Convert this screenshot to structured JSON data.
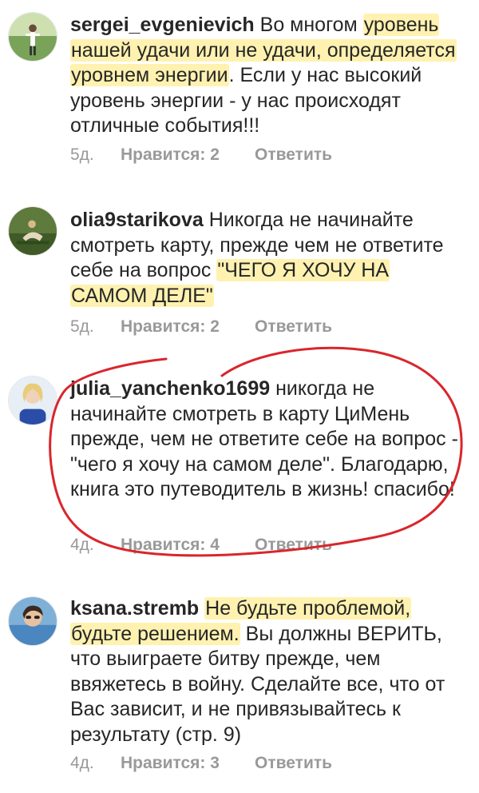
{
  "comments": [
    {
      "username": "sergei_evgenievich",
      "text_plain_start": " Во многом ",
      "text_highlight": "уровень нашей удачи или не удачи, определяется уровнем энергии",
      "text_plain_end": ". Если у нас высокий уровень энергии - у нас происходят отличные события!!!",
      "time": "5д.",
      "likes": "Нравится: 2",
      "reply": "Ответить"
    },
    {
      "username": "olia9starikova",
      "text_plain_start": " Никогда не начинайте смотреть карту, прежде чем не ответите себе на вопрос ",
      "text_highlight": "\"ЧЕГО Я ХОЧУ НА САМОМ ДЕЛЕ\"",
      "text_plain_end": "",
      "time": "5д.",
      "likes": "Нравится: 2",
      "reply": "Ответить"
    },
    {
      "username": "julia_yanchenko1699",
      "text_plain_start": " никогда не начинайте смотреть в карту ЦиМень прежде, чем не ответите себе на вопрос - \"чего я хочу на самом деле\". Благодарю, книга это путеводитель в жизнь! спасибо!",
      "text_highlight": "",
      "text_plain_end": "",
      "time": "4д.",
      "likes": "Нравится: 4",
      "reply": "Ответить"
    },
    {
      "username": "ksana.stremb",
      "text_plain_start": " ",
      "text_highlight": "Не будьте проблемой, будьте решением.",
      "text_plain_end": " Вы должны ВЕРИТЬ, что выиграете битву прежде, чем ввяжетесь в войну. Сделайте все, что от Вас зависит, и не привязывайтесь к результату (стр. 9)",
      "time": "4д.",
      "likes": "Нравится: 3",
      "reply": "Ответить"
    }
  ],
  "colors": {
    "highlight": "#ffee96",
    "circle": "#d9262c",
    "meta": "#999999",
    "text": "#262626"
  }
}
